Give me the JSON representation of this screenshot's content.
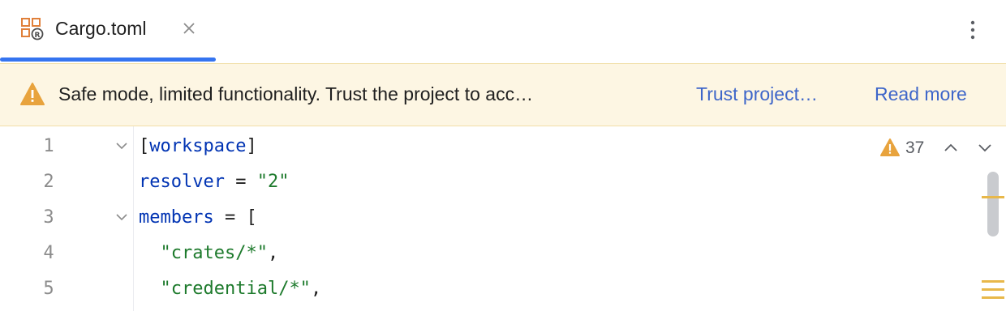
{
  "tab": {
    "file_name": "Cargo.toml",
    "icon": "cargo-file-icon",
    "close_icon": "close-icon"
  },
  "toolbar": {
    "more_icon": "more-vertical-icon"
  },
  "banner": {
    "icon": "warning-icon",
    "message": "Safe mode, limited functionality. Trust the project to acc…",
    "trust_link": "Trust project…",
    "read_more_link": "Read more"
  },
  "inspections": {
    "icon": "warning-icon",
    "count": "37",
    "prev_icon": "chevron-up-icon",
    "next_icon": "chevron-down-icon"
  },
  "editor": {
    "lines": [
      {
        "number": "1",
        "fold": true,
        "tokens": [
          {
            "t": "p",
            "v": "["
          },
          {
            "t": "k",
            "v": "workspace"
          },
          {
            "t": "p",
            "v": "]"
          }
        ]
      },
      {
        "number": "2",
        "fold": false,
        "tokens": [
          {
            "t": "k",
            "v": "resolver"
          },
          {
            "t": "p",
            "v": " = "
          },
          {
            "t": "s",
            "v": "\"2\""
          }
        ]
      },
      {
        "number": "3",
        "fold": true,
        "tokens": [
          {
            "t": "k",
            "v": "members"
          },
          {
            "t": "p",
            "v": " = ["
          }
        ]
      },
      {
        "number": "4",
        "fold": false,
        "tokens": [
          {
            "t": "p",
            "v": "  "
          },
          {
            "t": "s",
            "v": "\"crates/*\""
          },
          {
            "t": "p",
            "v": ","
          }
        ]
      },
      {
        "number": "5",
        "fold": false,
        "tokens": [
          {
            "t": "p",
            "v": "  "
          },
          {
            "t": "s",
            "v": "\"credential/*\""
          },
          {
            "t": "p",
            "v": ","
          }
        ]
      }
    ]
  },
  "colors": {
    "accent": "#3574f0",
    "banner_bg": "#fdf6e3",
    "link": "#3e66c9",
    "keyword": "#0033b3",
    "string": "#1d7a2c",
    "warning": "#e8a33d"
  }
}
